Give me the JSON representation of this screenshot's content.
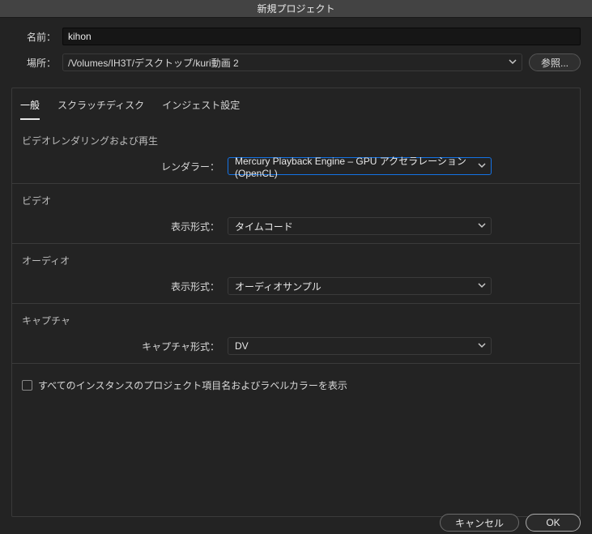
{
  "titlebar": {
    "text": "新規プロジェクト"
  },
  "fields": {
    "name_label": "名前：",
    "name_value": "kihon",
    "location_label": "場所：",
    "location_value": "/Volumes/IH3T/デスクトップ/kuri動画 2",
    "browse_label": "参照..."
  },
  "tabs": {
    "general": "一般",
    "scratch": "スクラッチディスク",
    "ingest": "インジェスト設定"
  },
  "sections": {
    "render_heading": "ビデオレンダリングおよび再生",
    "renderer_label": "レンダラー：",
    "renderer_value": "Mercury Playback Engine – GPU アクセラレーション (OpenCL)",
    "video_heading": "ビデオ",
    "video_display_label": "表示形式：",
    "video_display_value": "タイムコード",
    "audio_heading": "オーディオ",
    "audio_display_label": "表示形式：",
    "audio_display_value": "オーディオサンプル",
    "capture_heading": "キャプチャ",
    "capture_format_label": "キャプチャ形式：",
    "capture_format_value": "DV"
  },
  "checkbox": {
    "label": "すべてのインスタンスのプロジェクト項目名およびラベルカラーを表示"
  },
  "footer": {
    "cancel": "キャンセル",
    "ok": "OK"
  }
}
